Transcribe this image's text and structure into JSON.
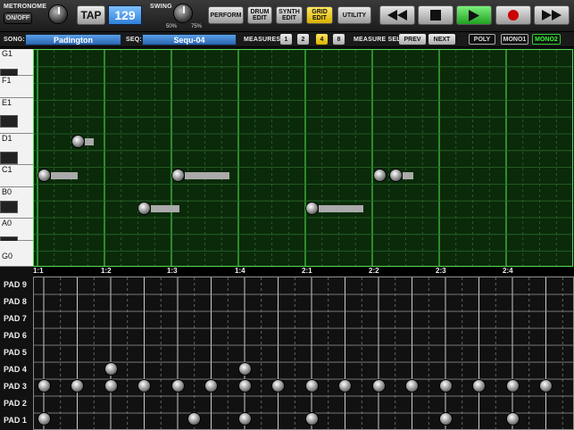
{
  "header": {
    "metronome_label": "METRONOME",
    "onoff_label": "ON/OFF",
    "tap_label": "TAP",
    "bpm": "129",
    "swing_label": "SWING",
    "swing_min": "50%",
    "swing_max": "75%",
    "modes": [
      "PERFORM",
      "DRUM EDIT",
      "SYNTH EDIT",
      "GRID EDIT",
      "UTILITY"
    ],
    "active_mode": "GRID EDIT"
  },
  "transport": {
    "rewind_icon": "rewind-icon",
    "stop_icon": "stop-icon",
    "play_icon": "play-icon",
    "record_icon": "record-icon",
    "ffwd_icon": "fast-forward-icon"
  },
  "songbar": {
    "song_label": "SONG:",
    "song_value": "Padington",
    "seq_label": "SEQ:",
    "seq_value": "Sequ-04",
    "measures_label": "MEASURES:",
    "measures": [
      "1",
      "2",
      "4",
      "8"
    ],
    "active_measure": "4",
    "measure_sel_label": "MEASURE SEL:",
    "prev_label": "PREV",
    "next_label": "NEXT",
    "voice_modes": [
      "POLY",
      "MONO1",
      "MONO2"
    ],
    "active_voice": "MONO2"
  },
  "piano": {
    "labels": [
      "G1",
      "F1",
      "E1",
      "D1",
      "C1",
      "B0",
      "A0",
      "G0"
    ]
  },
  "ruler": {
    "labels": [
      "1:1",
      "1:2",
      "1:3",
      "1:4",
      "2:1",
      "2:2",
      "2:3",
      "2:4"
    ]
  },
  "pads": {
    "labels": [
      "PAD 9",
      "PAD 8",
      "PAD 7",
      "PAD 6",
      "PAD 5",
      "PAD 4",
      "PAD 3",
      "PAD 2",
      "PAD 1"
    ]
  },
  "colors": {
    "grid_bg": "#0a2a0a",
    "grid_line": "#3c3",
    "accent_blue": "#2a64b0",
    "active_yellow": "#ffd700"
  }
}
